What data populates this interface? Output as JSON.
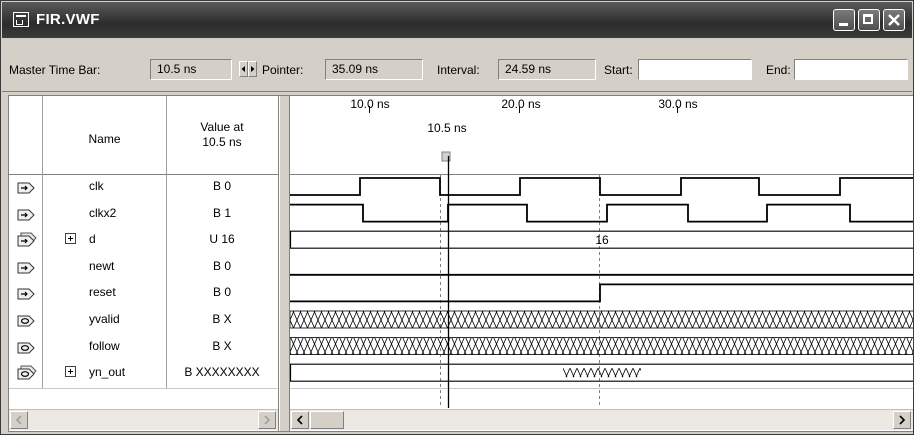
{
  "window": {
    "title": "FIR.VWF"
  },
  "toolbar": {
    "master_label": "Master Time Bar:",
    "master_value": "10.5 ns",
    "pointer_label": "Pointer:",
    "pointer_value": "35.09 ns",
    "interval_label": "Interval:",
    "interval_value": "24.59 ns",
    "start_label": "Start:",
    "start_value": "",
    "end_label": "End:",
    "end_value": ""
  },
  "columns": {
    "name": "Name",
    "value_line1": "Value at",
    "value_line2": "10.5 ns"
  },
  "timeline": {
    "ticks": [
      "10.0 ns",
      "20.0 ns",
      "30.0 ns"
    ],
    "marker_label": "10.5 ns"
  },
  "signals": [
    {
      "name": "clk",
      "value": "B 0",
      "icon": "input-pin-icon",
      "expandable": false
    },
    {
      "name": "clkx2",
      "value": "B 1",
      "icon": "input-pin-icon",
      "expandable": false
    },
    {
      "name": "d",
      "value": "U 16",
      "icon": "input-bus-icon",
      "expandable": true
    },
    {
      "name": "newt",
      "value": "B 0",
      "icon": "input-pin-icon",
      "expandable": false
    },
    {
      "name": "reset",
      "value": "B 0",
      "icon": "input-pin-icon",
      "expandable": false
    },
    {
      "name": "yvalid",
      "value": "B X",
      "icon": "output-pin-icon",
      "expandable": false
    },
    {
      "name": "follow",
      "value": "B X",
      "icon": "output-pin-icon",
      "expandable": false
    },
    {
      "name": "yn_out",
      "value": "B XXXXXXXX",
      "icon": "output-bus-icon",
      "expandable": true
    }
  ],
  "waveforms": {
    "d_bus_value": "16"
  }
}
